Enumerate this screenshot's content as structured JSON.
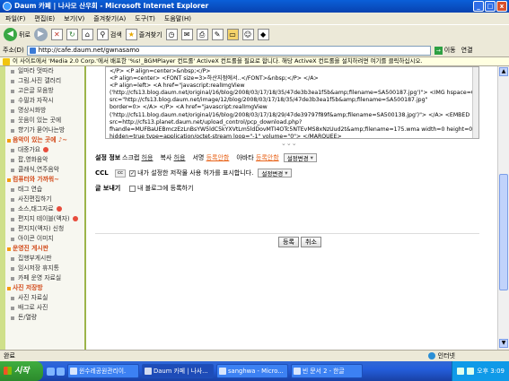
{
  "window": {
    "title": "Daum 카페 | 나사모 산우회 - Microsoft Internet Explorer",
    "buttons": [
      "_",
      "□",
      "x"
    ]
  },
  "menu": [
    "파일(F)",
    "편집(E)",
    "보기(V)",
    "즐겨찾기(A)",
    "도구(T)",
    "도움말(H)"
  ],
  "toolbar": {
    "back": "뒤로",
    "search": "검색",
    "favorites": "즐겨찾기"
  },
  "address": {
    "label": "주소(D)",
    "url": "http://cafe.daum.net/gwnasamo",
    "go": "이동",
    "links": "연결"
  },
  "infobar": "이 사이트에서 'Media 2.0 Corp.'에서 배포한 '%s!_BGMPlayer 컨트롤' ActiveX 컨트롤을 필요로 합니다. 해당 ActiveX 컨트롤을 설치하려면 여기를 클릭하십시오.",
  "sidebar": [
    {
      "t": "일마라 멋따라",
      "h": false,
      "n": false
    },
    {
      "t": "그림.사진 갤러리",
      "h": false,
      "n": false
    },
    {
      "t": "고은글 모음방",
      "h": false,
      "n": false
    },
    {
      "t": "수필과 자작시",
      "h": false,
      "n": false
    },
    {
      "t": "명상시화방",
      "h": false,
      "n": false
    },
    {
      "t": "웃음이 있는 곳에",
      "h": false,
      "n": false
    },
    {
      "t": "향기가 묻어나는방",
      "h": false,
      "n": false
    },
    {
      "t": "음악이 있는 곳에 ♪~",
      "h": true,
      "n": false
    },
    {
      "t": "대중가요",
      "h": false,
      "n": true
    },
    {
      "t": "팝,영화음악",
      "h": false,
      "n": false
    },
    {
      "t": "클래식,연주음악",
      "h": false,
      "n": false
    },
    {
      "t": "컴퓨터와 가까워~",
      "h": true,
      "n": false
    },
    {
      "t": "태그 연습",
      "h": false,
      "n": false
    },
    {
      "t": "사진편집하기",
      "h": false,
      "n": false
    },
    {
      "t": "소스,태그자료",
      "h": false,
      "n": true
    },
    {
      "t": "편지지 테이블(액자)",
      "h": false,
      "n": true
    },
    {
      "t": "편지지(액자) 신청",
      "h": false,
      "n": false
    },
    {
      "t": "아이콘 이미지",
      "h": false,
      "n": false
    },
    {
      "t": "운영진 게시판",
      "h": true,
      "n": false
    },
    {
      "t": "집행부게시판",
      "h": false,
      "n": false
    },
    {
      "t": "임시저장 휴지통",
      "h": false,
      "n": false
    },
    {
      "t": "카페 운영 자료실",
      "h": false,
      "n": false
    },
    {
      "t": "사진 저장방",
      "h": true,
      "n": false
    },
    {
      "t": "사진 자료실",
      "h": false,
      "n": false
    },
    {
      "t": "배그로 사진",
      "h": false,
      "n": false
    },
    {
      "t": "돈/열량",
      "h": false,
      "n": false
    }
  ],
  "code_lines": [
    "</P> <P align=center>&nbsp;</P>",
    "<P align=center> <FONT size=3>하산지점에서..</FONT>&nbsp;</P> </A>",
    "<P align=left> <A href=\"javascript:realImgView",
    "('http://cfs13.blog.daum.net/original/16/blog/2008/03/17/18/35/47de3b3ea1f5b&amp;filename=SA500187.jpg')\"> <IMG hspace=0",
    "src=\"http://cfs13.blog.daum.net/image/12/blog/2008/03/17/18/35/47de3b3ea1f5b&amp;filename=SA500187.jpg\"",
    "border=0> </A> </P> <A href=\"javascript:realImgView",
    "('http://cfs11.blog.daum.net/original/16/blog/2008/03/17/18/29/47de39797f89f&amp;filename=SA500138.jpg')\"> </A> <EMBED",
    "src=http://cfs13.planet.daum.net/upload_control/pcp_download.php?",
    "fhandle=MUFBaUEBmczEzLnBsYW5ldC5kYXVtLm5ldDovMTI4OTc5NTEvMS8xNzUud2t&amp;filename=175.wma width=0 height=00",
    "hidden=true type=application/octet-stream loop=\"-1\" volume=\"0\"> </MARQUEE>"
  ],
  "handle": "⌄⌄⌄",
  "options": {
    "row1_label": "설정 정보",
    "scrap": "스크랩",
    "scrap_v": "허용",
    "copy": "복사",
    "copy_v": "허용",
    "pub": "서명",
    "pub_v": "등록안함",
    "ava": "아바타",
    "ava_v": "등록안함",
    "set": "설정변경",
    "ccl_label": "CCL",
    "ccl_text": "내가 설정한 저작물 사용 허가를 표시합니다.",
    "ccl_btn": "설정변경",
    "post_label": "글 보내기",
    "post_text": "내 블로그에 등록하기"
  },
  "buttons": {
    "submit": "등록",
    "cancel": "취소"
  },
  "status": {
    "text": "완료",
    "zone": "인터넷"
  },
  "taskbar": {
    "start": "시작",
    "tasks": [
      "윈수레공원관리이.",
      "Daum 카페 | 나사...",
      "sanghwa - Micro...",
      "빈 문서 2 - 한글"
    ],
    "time": "오후 3:09"
  }
}
